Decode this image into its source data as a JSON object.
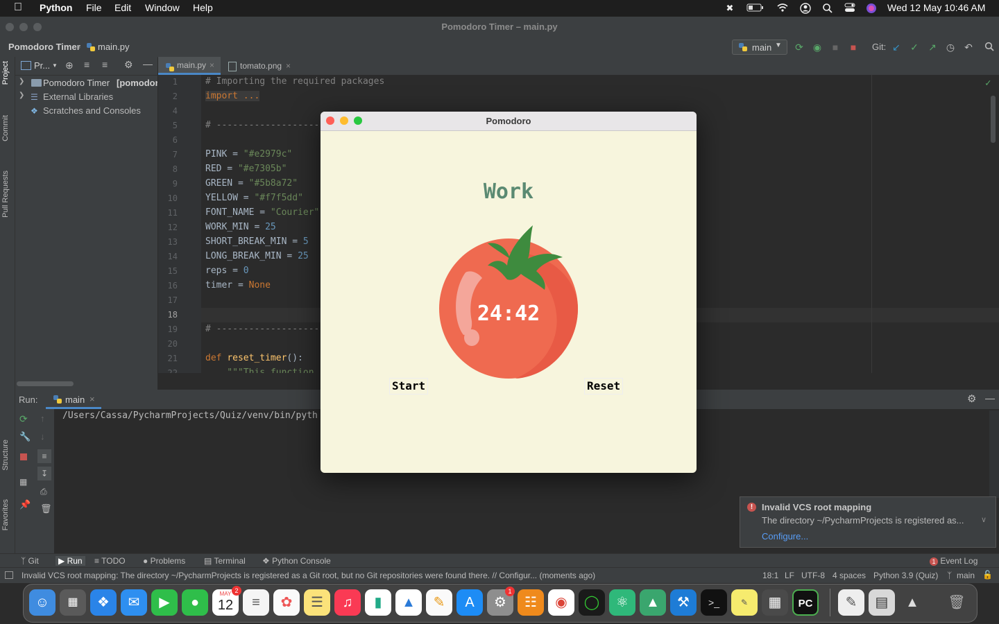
{
  "menubar": {
    "app_name": "Python",
    "menus": [
      "File",
      "Edit",
      "Window",
      "Help"
    ],
    "datetime": "Wed 12 May  10:46 AM"
  },
  "ide": {
    "window_title": "Pomodoro Timer – main.py",
    "breadcrumb": [
      "Pomodoro Timer",
      "main.py"
    ],
    "branch": "main",
    "git_label": "Git:",
    "project_header": "Pr...",
    "project_tree": [
      {
        "label": "Pomodoro Timer",
        "suffix": "[pomodor"
      },
      {
        "label": "External Libraries",
        "suffix": ""
      },
      {
        "label": "Scratches and Consoles",
        "suffix": ""
      }
    ],
    "editor_tabs": [
      "main.py",
      "tomato.png"
    ],
    "left_tabs": [
      "Project",
      "Commit",
      "Pull Requests",
      "Structure",
      "Favorites"
    ]
  },
  "code": {
    "line_numbers": [
      "1",
      "2",
      "4",
      "5",
      "6",
      "7",
      "8",
      "9",
      "10",
      "11",
      "12",
      "13",
      "14",
      "15",
      "16",
      "17",
      "18",
      "19",
      "20",
      "21",
      "22"
    ],
    "lines": {
      "l1": "# Importing the required packages",
      "l2": "import ...",
      "l5": "# -------------------",
      "l7a": "PINK = ",
      "l7b": "\"#e2979c\"",
      "l8a": "RED = ",
      "l8b": "\"#e7305b\"",
      "l9a": "GREEN = ",
      "l9b": "\"#5b8a72\"",
      "l10a": "YELLOW = ",
      "l10b": "\"#f7f5dd\"",
      "l11a": "FONT_NAME = ",
      "l11b": "\"Courier\"",
      "l12a": "WORK_MIN = ",
      "l12b": "25",
      "l13a": "SHORT_BREAK_MIN = ",
      "l13b": "5",
      "l14a": "LONG_BREAK_MIN = ",
      "l14b": "25",
      "l15a": "reps = ",
      "l15b": "0",
      "l16a": "timer = ",
      "l16b": "None",
      "l19": "# -------------------",
      "l21a": "def ",
      "l21b": "reset_timer",
      "l21c": "():",
      "l22": "    \"\"\"This function"
    }
  },
  "run": {
    "label": "Run:",
    "config": "main",
    "output": "/Users/Cassa/PycharmProjects/Quiz/venv/bin/pyth"
  },
  "bottom_tabs": [
    "Git",
    "Run",
    "TODO",
    "Problems",
    "Terminal",
    "Python Console"
  ],
  "event_log": "Event Log",
  "event_count": "1",
  "status": {
    "message": "Invalid VCS root mapping: The directory ~/PycharmProjects is registered as a Git root, but no Git repositories were found there. // Configur... (moments ago)",
    "position": "18:1",
    "line_sep": "LF",
    "encoding": "UTF-8",
    "indent": "4 spaces",
    "interpreter": "Python 3.9 (Quiz)",
    "branch": "main"
  },
  "notification": {
    "title": "Invalid VCS root mapping",
    "body": "The directory ~/PycharmProjects is registered as...",
    "link": "Configure..."
  },
  "pomodoro": {
    "window_title": "Pomodoro",
    "heading": "Work",
    "timer": "24:42",
    "start_label": "Start",
    "reset_label": "Reset",
    "heading_color": "#5b8a72",
    "bg_color": "#f7f5dd"
  },
  "dock": {
    "calendar_month": "MAY",
    "calendar_day": "12",
    "calendar_badge": "2",
    "settings_badge": "1",
    "pycharm_label": "PC"
  }
}
